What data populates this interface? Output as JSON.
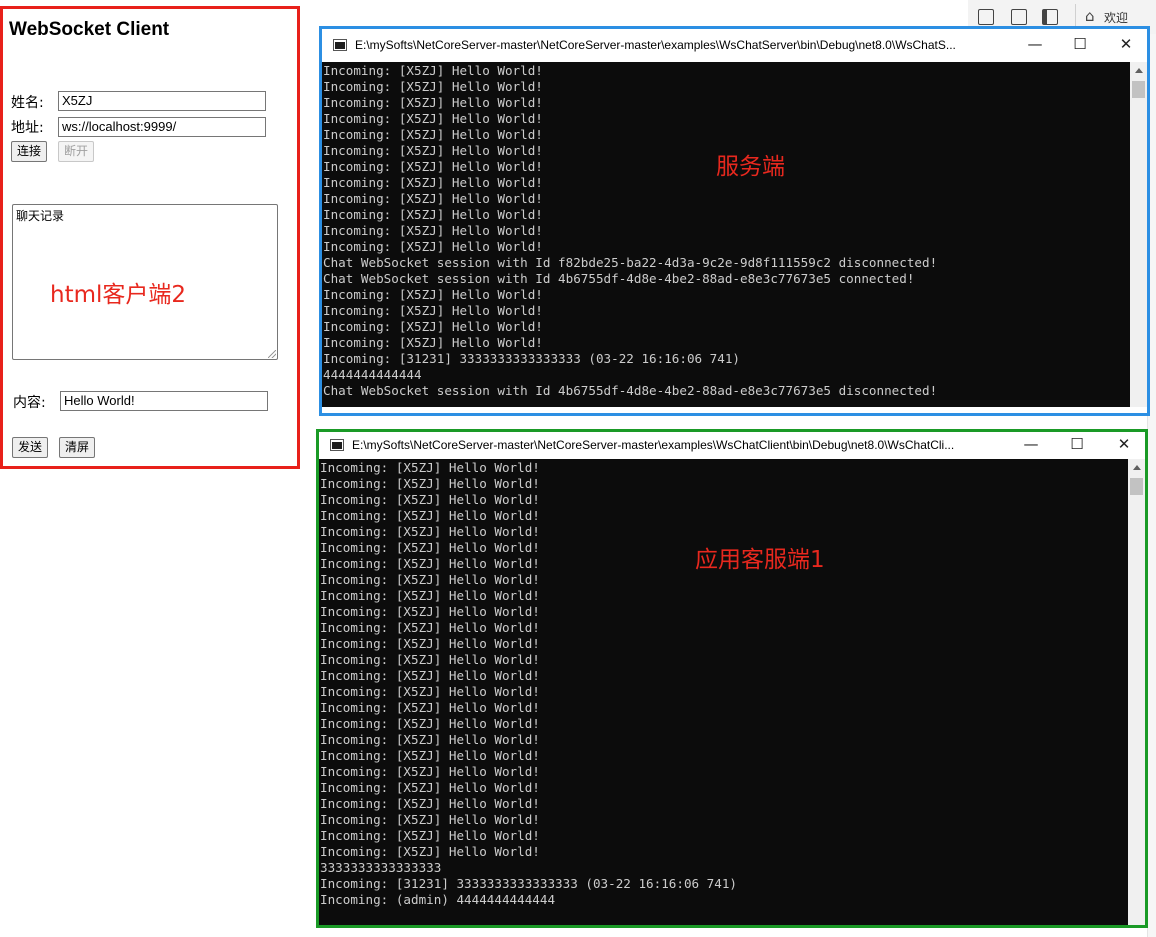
{
  "html_client": {
    "title": "WebSocket Client",
    "name_label": "姓名:",
    "name_value": "X5ZJ",
    "address_label": "地址:",
    "address_value": "ws://localhost:9999/",
    "connect_label": "连接",
    "disconnect_label": "断开",
    "chat_log_text": "聊天记录",
    "content_label": "内容:",
    "content_value": "Hello World!",
    "send_label": "发送",
    "clear_label": "清屏",
    "annotation": "html客户端2",
    "border_color": "#e8201a"
  },
  "background_window": {
    "welcome_text": "欢迎"
  },
  "server_console": {
    "title": "E:\\mySofts\\NetCoreServer-master\\NetCoreServer-master\\examples\\WsChatServer\\bin\\Debug\\net8.0\\WsChatS...",
    "annotation": "服务端",
    "border_color": "#2c8fe3",
    "lines": [
      "Incoming: [X5ZJ] Hello World!",
      "Incoming: [X5ZJ] Hello World!",
      "Incoming: [X5ZJ] Hello World!",
      "Incoming: [X5ZJ] Hello World!",
      "Incoming: [X5ZJ] Hello World!",
      "Incoming: [X5ZJ] Hello World!",
      "Incoming: [X5ZJ] Hello World!",
      "Incoming: [X5ZJ] Hello World!",
      "Incoming: [X5ZJ] Hello World!",
      "Incoming: [X5ZJ] Hello World!",
      "Incoming: [X5ZJ] Hello World!",
      "Incoming: [X5ZJ] Hello World!",
      "Chat WebSocket session with Id f82bde25-ba22-4d3a-9c2e-9d8f111559c2 disconnected!",
      "Chat WebSocket session with Id 4b6755df-4d8e-4be2-88ad-e8e3c77673e5 connected!",
      "Incoming: [X5ZJ] Hello World!",
      "Incoming: [X5ZJ] Hello World!",
      "Incoming: [X5ZJ] Hello World!",
      "Incoming: [X5ZJ] Hello World!",
      "Incoming: [31231] 3333333333333333 (03-22 16:16:06 741)",
      "4444444444444",
      "Chat WebSocket session with Id 4b6755df-4d8e-4be2-88ad-e8e3c77673e5 disconnected!"
    ]
  },
  "client_console": {
    "title": "E:\\mySofts\\NetCoreServer-master\\NetCoreServer-master\\examples\\WsChatClient\\bin\\Debug\\net8.0\\WsChatCli...",
    "annotation": "应用客服端1",
    "border_color": "#1a9a26",
    "lines": [
      "Incoming: [X5ZJ] Hello World!",
      "Incoming: [X5ZJ] Hello World!",
      "Incoming: [X5ZJ] Hello World!",
      "Incoming: [X5ZJ] Hello World!",
      "Incoming: [X5ZJ] Hello World!",
      "Incoming: [X5ZJ] Hello World!",
      "Incoming: [X5ZJ] Hello World!",
      "Incoming: [X5ZJ] Hello World!",
      "Incoming: [X5ZJ] Hello World!",
      "Incoming: [X5ZJ] Hello World!",
      "Incoming: [X5ZJ] Hello World!",
      "Incoming: [X5ZJ] Hello World!",
      "Incoming: [X5ZJ] Hello World!",
      "Incoming: [X5ZJ] Hello World!",
      "Incoming: [X5ZJ] Hello World!",
      "Incoming: [X5ZJ] Hello World!",
      "Incoming: [X5ZJ] Hello World!",
      "Incoming: [X5ZJ] Hello World!",
      "Incoming: [X5ZJ] Hello World!",
      "Incoming: [X5ZJ] Hello World!",
      "Incoming: [X5ZJ] Hello World!",
      "Incoming: [X5ZJ] Hello World!",
      "Incoming: [X5ZJ] Hello World!",
      "Incoming: [X5ZJ] Hello World!",
      "Incoming: [X5ZJ] Hello World!",
      "3333333333333333",
      "Incoming: [31231] 3333333333333333 (03-22 16:16:06 741)",
      "Incoming: (admin) 4444444444444"
    ]
  },
  "window_controls": {
    "minimize": "—",
    "maximize": "☐",
    "close": "✕"
  },
  "colors": {
    "annotation": "#e8281e",
    "console_bg": "#0c0c0c",
    "console_text": "#cccccc"
  }
}
